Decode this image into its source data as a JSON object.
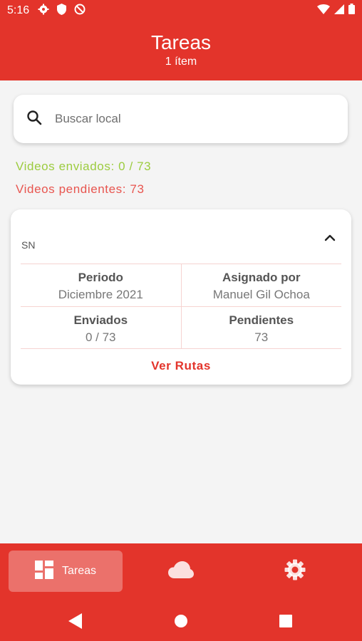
{
  "status_bar": {
    "time": "5:16",
    "left_icons": [
      "settings-icon",
      "shield-icon",
      "do-not-disturb-icon"
    ],
    "right_icons": [
      "wifi-icon",
      "signal-icon",
      "battery-icon"
    ]
  },
  "header": {
    "title": "Tareas",
    "subtitle": "1 ítem"
  },
  "search": {
    "placeholder": "Buscar local",
    "value": ""
  },
  "stats": {
    "sent": "Videos enviados: 0 / 73",
    "pending": "Videos pendientes: 73"
  },
  "card": {
    "code": "SN",
    "expanded": true,
    "period_label": "Periodo",
    "period_value": "Diciembre 2021",
    "assigned_label": "Asignado por",
    "assigned_value": "Manuel Gil Ochoa",
    "sent_label": "Enviados",
    "sent_value": "0 / 73",
    "pending_label": "Pendientes",
    "pending_value": "73",
    "link_label": "Ver Rutas"
  },
  "bottom_nav": {
    "items": [
      {
        "label": "Tareas",
        "icon": "dashboard-icon",
        "active": true
      },
      {
        "icon": "cloud-icon",
        "active": false
      },
      {
        "icon": "settings-icon",
        "active": false
      }
    ]
  },
  "colors": {
    "primary": "#e3342b",
    "sent_text": "#9ccc3f",
    "pending_text": "#e8554f",
    "background": "#f4f4f4"
  }
}
